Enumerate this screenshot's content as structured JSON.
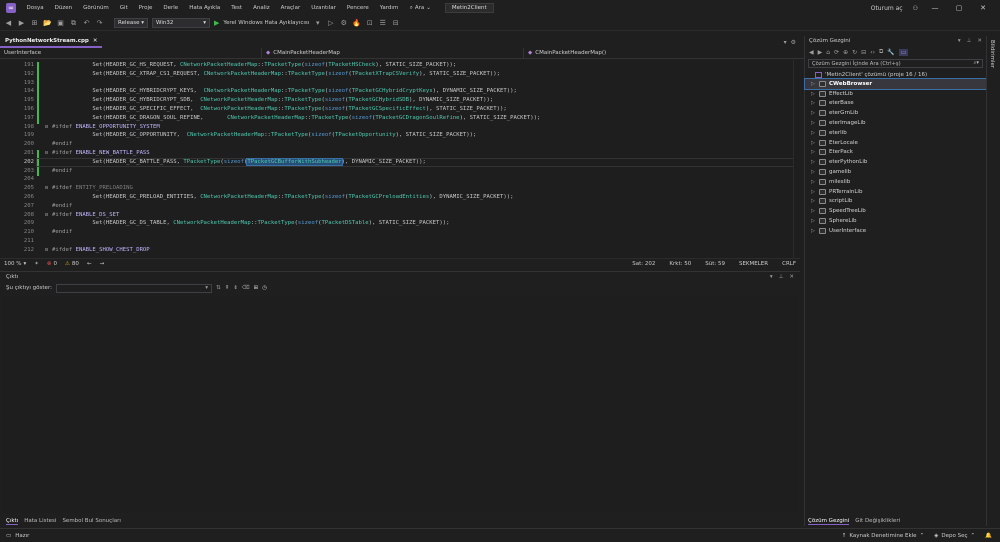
{
  "menu": {
    "items": [
      "Dosya",
      "Düzen",
      "Görünüm",
      "Git",
      "Proje",
      "Derle",
      "Hata Ayıkla",
      "Test",
      "Analiz",
      "Araçlar",
      "Uzantılar",
      "Pencere",
      "Yardım"
    ],
    "search_label": "Ara",
    "solution_name": "Metin2Client",
    "signin": "Oturum aç"
  },
  "toolbar": {
    "config": "Release",
    "platform": "Win32",
    "debugger": "Yerel Windows Hata Ayıklayıcısı"
  },
  "editor": {
    "tab_label": "PythonNetworkStream.cpp",
    "nav_project": "UserInterface",
    "nav_scope": "CMainPacketHeaderMap",
    "nav_member": "CMainPacketHeaderMap()",
    "current_line": "202",
    "lines": [
      {
        "n": "191",
        "fold": "",
        "code": [
          [
            "df",
            "            Set(HEADER_GC_HS_REQUEST, "
          ],
          [
            "ty",
            "CNetworkPacketHeaderMap"
          ],
          [
            "df",
            "::"
          ],
          [
            "ty",
            "TPacketType"
          ],
          [
            "df",
            "("
          ],
          [
            "kw",
            "sizeof"
          ],
          [
            "df",
            "("
          ],
          [
            "ty",
            "TPacketHSCheck"
          ],
          [
            "df",
            "), STATIC_SIZE_PACKET));"
          ]
        ]
      },
      {
        "n": "192",
        "fold": "",
        "code": [
          [
            "df",
            "            Set(HEADER_GC_XTRAP_CS1_REQUEST, "
          ],
          [
            "ty",
            "CNetworkPacketHeaderMap"
          ],
          [
            "df",
            "::"
          ],
          [
            "ty",
            "TPacketType"
          ],
          [
            "df",
            "("
          ],
          [
            "kw",
            "sizeof"
          ],
          [
            "df",
            "("
          ],
          [
            "ty",
            "TPacketXTrapCSVerify"
          ],
          [
            "df",
            "), STATIC_SIZE_PACKET));"
          ]
        ]
      },
      {
        "n": "193",
        "fold": "",
        "code": []
      },
      {
        "n": "194",
        "fold": "",
        "code": [
          [
            "df",
            "            Set(HEADER_GC_HYBRIDCRYPT_KEYS,  "
          ],
          [
            "ty",
            "CNetworkPacketHeaderMap"
          ],
          [
            "df",
            "::"
          ],
          [
            "ty",
            "TPacketType"
          ],
          [
            "df",
            "("
          ],
          [
            "kw",
            "sizeof"
          ],
          [
            "df",
            "("
          ],
          [
            "ty",
            "TPacketGCHybridCryptKeys"
          ],
          [
            "df",
            "), DYNAMIC_SIZE_PACKET));"
          ]
        ]
      },
      {
        "n": "195",
        "fold": "",
        "code": [
          [
            "df",
            "            Set(HEADER_GC_HYBRIDCRYPT_SDB,  "
          ],
          [
            "ty",
            "CNetworkPacketHeaderMap"
          ],
          [
            "df",
            "::"
          ],
          [
            "ty",
            "TPacketType"
          ],
          [
            "df",
            "("
          ],
          [
            "kw",
            "sizeof"
          ],
          [
            "df",
            "("
          ],
          [
            "ty",
            "TPacketGCHybridSDB"
          ],
          [
            "df",
            "), DYNAMIC_SIZE_PACKET));"
          ]
        ]
      },
      {
        "n": "196",
        "fold": "",
        "code": [
          [
            "df",
            "            Set(HEADER_GC_SPECIFIC_EFFECT,  "
          ],
          [
            "ty",
            "CNetworkPacketHeaderMap"
          ],
          [
            "df",
            "::"
          ],
          [
            "ty",
            "TPacketType"
          ],
          [
            "df",
            "("
          ],
          [
            "kw",
            "sizeof"
          ],
          [
            "df",
            "("
          ],
          [
            "ty",
            "TPacketGCSpecificEffect"
          ],
          [
            "df",
            "), STATIC_SIZE_PACKET));"
          ]
        ]
      },
      {
        "n": "197",
        "fold": "",
        "code": [
          [
            "df",
            "            Set(HEADER_GC_DRAGON_SOUL_REFINE,       "
          ],
          [
            "ty",
            "CNetworkPacketHeaderMap"
          ],
          [
            "df",
            "::"
          ],
          [
            "ty",
            "TPacketType"
          ],
          [
            "df",
            "("
          ],
          [
            "kw",
            "sizeof"
          ],
          [
            "df",
            "("
          ],
          [
            "ty",
            "TPacketGCDragonSoulRefine"
          ],
          [
            "df",
            "), STATIC_SIZE_PACKET));"
          ]
        ]
      },
      {
        "n": "198",
        "fold": "⊟",
        "code": [
          [
            "pp",
            "#ifdef "
          ],
          [
            "mac",
            "ENABLE_OPPORTUNITY_SYSTEM"
          ]
        ]
      },
      {
        "n": "199",
        "fold": "",
        "code": [
          [
            "df",
            "            Set(HEADER_GC_OPPORTUNITY,  "
          ],
          [
            "ty",
            "CNetworkPacketHeaderMap"
          ],
          [
            "df",
            "::"
          ],
          [
            "ty",
            "TPacketType"
          ],
          [
            "df",
            "("
          ],
          [
            "kw",
            "sizeof"
          ],
          [
            "df",
            "("
          ],
          [
            "ty",
            "TPacketOpportunity"
          ],
          [
            "df",
            "), STATIC_SIZE_PACKET));"
          ]
        ]
      },
      {
        "n": "200",
        "fold": "",
        "code": [
          [
            "pp",
            "#endif"
          ]
        ]
      },
      {
        "n": "201",
        "fold": "⊟",
        "code": [
          [
            "pp",
            "#ifdef "
          ],
          [
            "mac",
            "ENABLE_NEW_BATTLE_PASS"
          ]
        ]
      },
      {
        "n": "202",
        "fold": "",
        "code": [
          [
            "df",
            "            Set(HEADER_GC_BATTLE_PASS, "
          ],
          [
            "ty",
            "TPacketType"
          ],
          [
            "df",
            "("
          ],
          [
            "kw",
            "sizeof"
          ],
          [
            "df",
            "("
          ],
          [
            "sel",
            "TPacketGCBufferWithSubheader"
          ],
          [
            "df",
            "), DYNAMIC_SIZE_PACKET));"
          ]
        ]
      },
      {
        "n": "203",
        "fold": "",
        "code": [
          [
            "pp",
            "#endif"
          ]
        ]
      },
      {
        "n": "204",
        "fold": "",
        "code": []
      },
      {
        "n": "205",
        "fold": "⊟",
        "code": [
          [
            "pp",
            "#ifdef "
          ],
          [
            "dim",
            "ENTITY_PRELOADING"
          ]
        ]
      },
      {
        "n": "206",
        "fold": "",
        "code": [
          [
            "df",
            "            Set(HEADER_GC_PRELOAD_ENTITIES, "
          ],
          [
            "ty",
            "CNetworkPacketHeaderMap"
          ],
          [
            "df",
            "::"
          ],
          [
            "ty",
            "TPacketType"
          ],
          [
            "df",
            "("
          ],
          [
            "kw",
            "sizeof"
          ],
          [
            "df",
            "("
          ],
          [
            "ty",
            "TPacketGCPreloadEntities"
          ],
          [
            "df",
            "), DYNAMIC_SIZE_PACKET));"
          ]
        ]
      },
      {
        "n": "207",
        "fold": "",
        "code": [
          [
            "pp",
            "#endif"
          ]
        ]
      },
      {
        "n": "208",
        "fold": "⊟",
        "code": [
          [
            "pp",
            "#ifdef "
          ],
          [
            "mac",
            "ENABLE_DS_SET"
          ]
        ]
      },
      {
        "n": "209",
        "fold": "",
        "code": [
          [
            "df",
            "            Set(HEADER_GC_DS_TABLE, "
          ],
          [
            "ty",
            "CNetworkPacketHeaderMap"
          ],
          [
            "df",
            "::"
          ],
          [
            "ty",
            "TPacketType"
          ],
          [
            "df",
            "("
          ],
          [
            "kw",
            "sizeof"
          ],
          [
            "df",
            "("
          ],
          [
            "ty",
            "TPacketDSTable"
          ],
          [
            "df",
            "), STATIC_SIZE_PACKET));"
          ]
        ]
      },
      {
        "n": "210",
        "fold": "",
        "code": [
          [
            "pp",
            "#endif"
          ]
        ]
      },
      {
        "n": "211",
        "fold": "",
        "code": []
      },
      {
        "n": "212",
        "fold": "⊟",
        "code": [
          [
            "pp",
            "#ifdef "
          ],
          [
            "mac",
            "ENABLE_SHOW_CHEST_DROP"
          ]
        ]
      }
    ]
  },
  "edstatus": {
    "zoom": "100 %",
    "errors": "0",
    "warnings": "80",
    "line": "Sat: 202",
    "char": "Krkt: 50",
    "col": "Süt: 59",
    "tabs": "SEKMELER",
    "eol": "CRLF"
  },
  "output": {
    "title": "Çıktı",
    "show_from": "Şu çıktıyı göster:"
  },
  "bottom_tabs": [
    "Çıktı",
    "Hata Listesi",
    "Sembol Bul Sonuçları"
  ],
  "solution": {
    "title": "Çözüm Gezgini",
    "search_placeholder": "Çözüm Gezgini İçinde Ara (Ctrl+ş)",
    "root": "'Metin2Client' çözümü (proje 16 / 16)",
    "projects": [
      "CWebBrowser",
      "EffectLib",
      "eterBase",
      "eterGrnLib",
      "eterImageLib",
      "eterlib",
      "EterLocale",
      "EterPack",
      "eterPythonLib",
      "gamelib",
      "mileslib",
      "PRTerrainLib",
      "scriptLib",
      "SpeedTreeLib",
      "SphereLib",
      "UserInterface"
    ],
    "tabs": [
      "Çözüm Gezgini",
      "Git Değişiklikleri"
    ],
    "side_label": "Bildirimler"
  },
  "status": {
    "ready": "Hazır",
    "source_control": "Kaynak Denetimine Ekle",
    "repo": "Depo Seç"
  }
}
